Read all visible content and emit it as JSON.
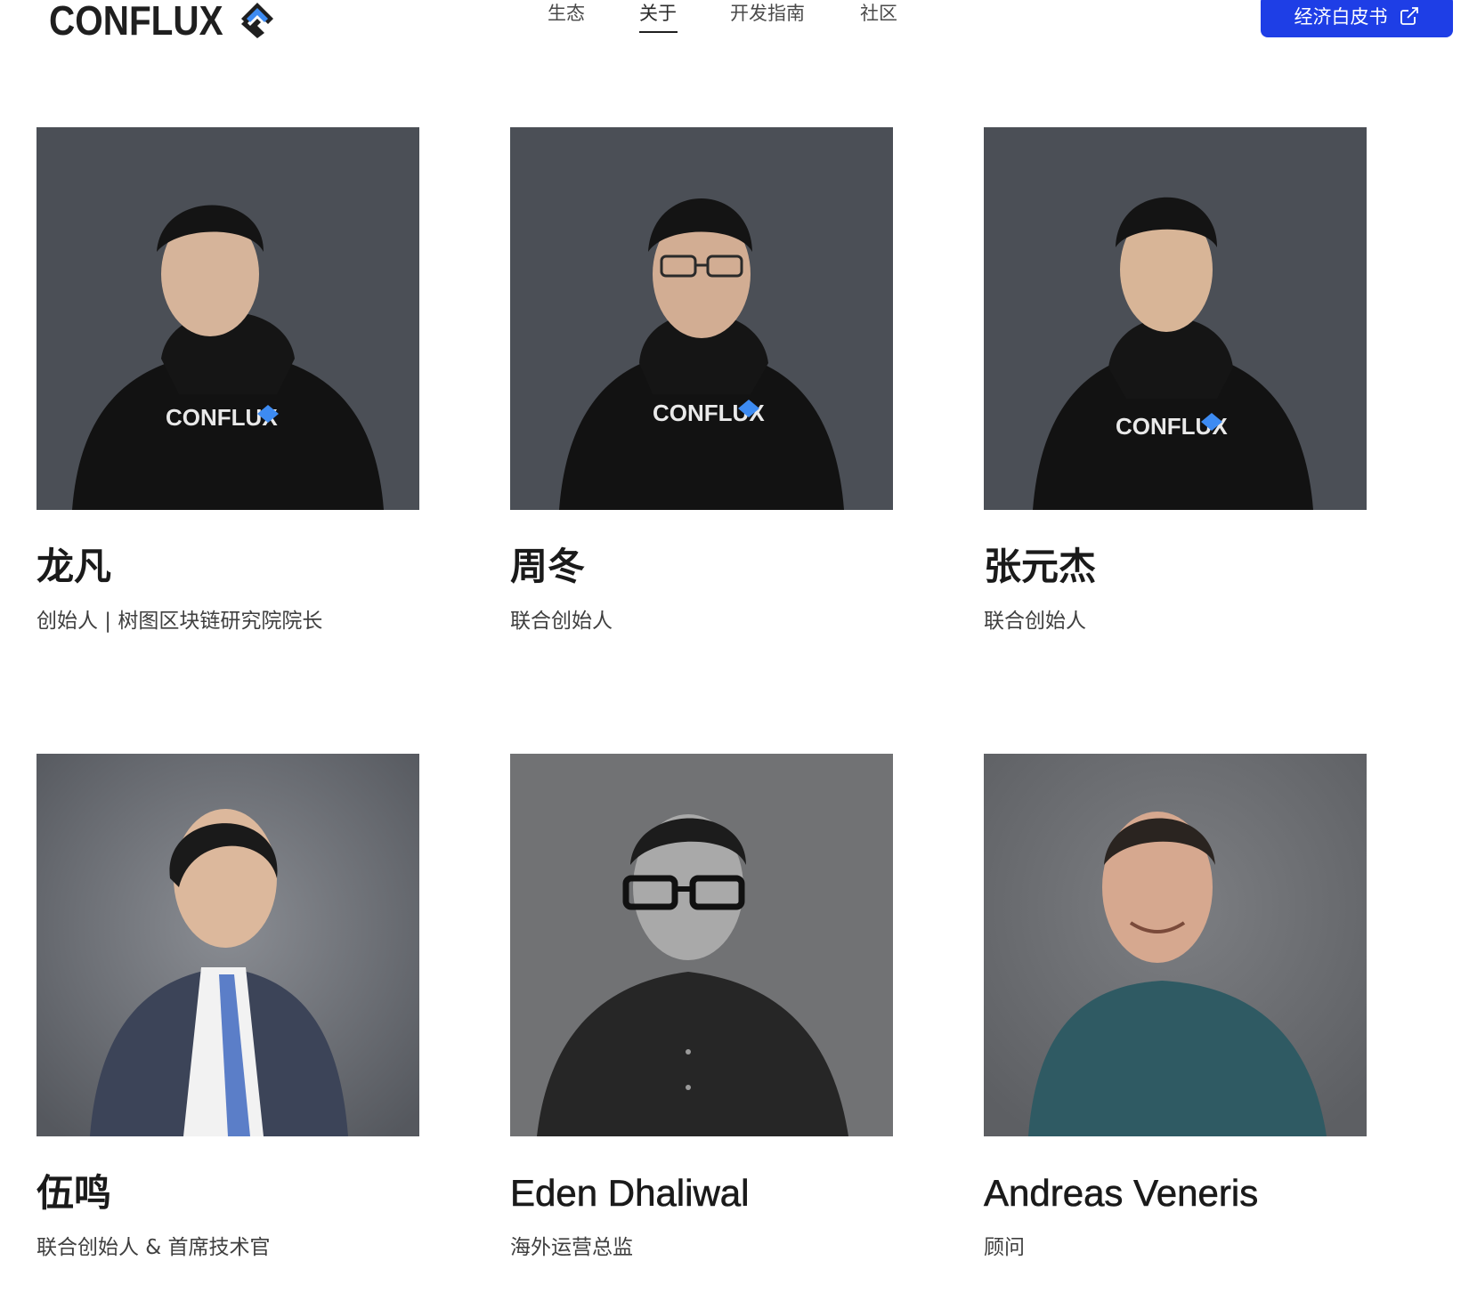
{
  "header": {
    "logo_text": "CONFLUX",
    "nav": [
      {
        "label": "生态",
        "active": false
      },
      {
        "label": "关于",
        "active": true
      },
      {
        "label": "开发指南",
        "active": false
      },
      {
        "label": "社区",
        "active": false
      }
    ],
    "cta_label": "经济白皮书"
  },
  "team": [
    {
      "name": "龙凡",
      "role": "创始人 | 树图区块链研究院院长",
      "photo_style": "dark-hoodie"
    },
    {
      "name": "周冬",
      "role": "联合创始人",
      "photo_style": "dark-hoodie-glasses"
    },
    {
      "name": "张元杰",
      "role": "联合创始人",
      "photo_style": "dark-hoodie"
    },
    {
      "name": "伍鸣",
      "role": "联合创始人 & 首席技术官",
      "photo_style": "suit"
    },
    {
      "name": "Eden Dhaliwal",
      "role": "海外运营总监",
      "photo_style": "grayscale-shirt-glasses"
    },
    {
      "name": "Andreas Veneris",
      "role": "顾问",
      "photo_style": "teal-tshirt"
    }
  ],
  "colors": {
    "accent": "#1e3ee6",
    "logo_blue": "#3d8bf2",
    "photo_bg_dark": "#4a4e55",
    "photo_bg_light": "#6f7178"
  }
}
